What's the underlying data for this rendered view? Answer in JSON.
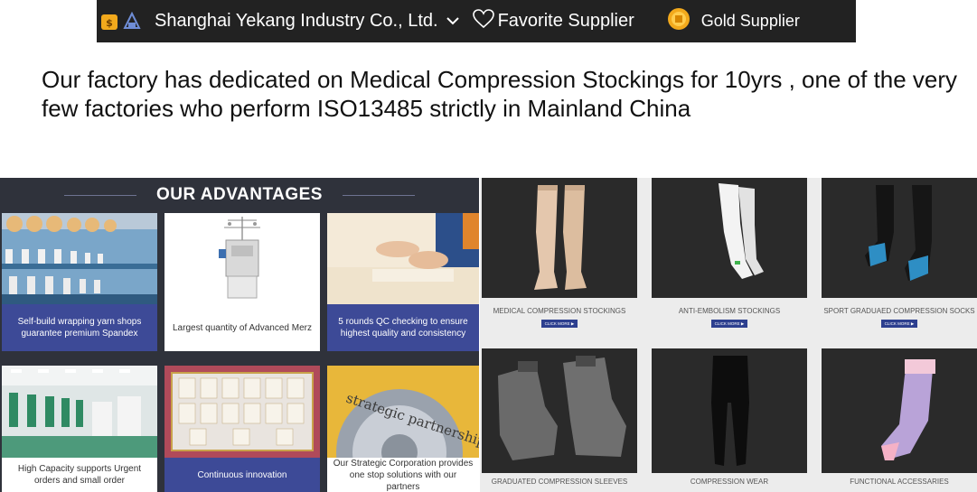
{
  "header": {
    "company_name": "Shanghai Yekang Industry Co., Ltd.",
    "favorite_label": "Favorite Supplier",
    "gold_label": "Gold Supplier",
    "icons": [
      "badge-icon",
      "verified-shield-icon",
      "chevron-down-icon",
      "heart-icon",
      "gold-medal-icon"
    ]
  },
  "headline": "Our factory has dedicated on Medical  Compression Stockings for 10yrs , one of the very few factories who perform ISO13485 strictly in Mainland China",
  "advantages": {
    "title": "OUR ADVANTAGES",
    "items": [
      {
        "caption": "Self-build wrapping yarn shops guarantee premium Spandex"
      },
      {
        "caption": "Largest quantity of Advanced Merz"
      },
      {
        "caption": "5 rounds QC checking to ensure highest quality and consistency"
      },
      {
        "caption": "High Capacity supports Urgent orders and small order"
      },
      {
        "caption": "Continuous innovation"
      },
      {
        "caption": "Our Strategic Corporation provides one stop solutions with our partners"
      }
    ],
    "partnership_text": "strategic partnership"
  },
  "products": {
    "button_label": "CLICK MORE ▶",
    "items": [
      {
        "name": "MEDICAL COMPRESSION STOCKINGS"
      },
      {
        "name": "ANTI-EMBOLISM STOCKINGS"
      },
      {
        "name": "SPORT GRADUAED COMPRESSION SOCKS"
      },
      {
        "name": "GRADUATED COMPRESSION SLEEVES"
      },
      {
        "name": "COMPRESSION WEAR"
      },
      {
        "name": "FUNCTIONAL ACCESSARIES"
      }
    ]
  },
  "colors": {
    "topbar": "#222222",
    "advantages_bg": "#2f323b",
    "caption_blue": "#3d4a97",
    "button_blue": "#2d3f8f",
    "gold": "#f2a91c"
  }
}
